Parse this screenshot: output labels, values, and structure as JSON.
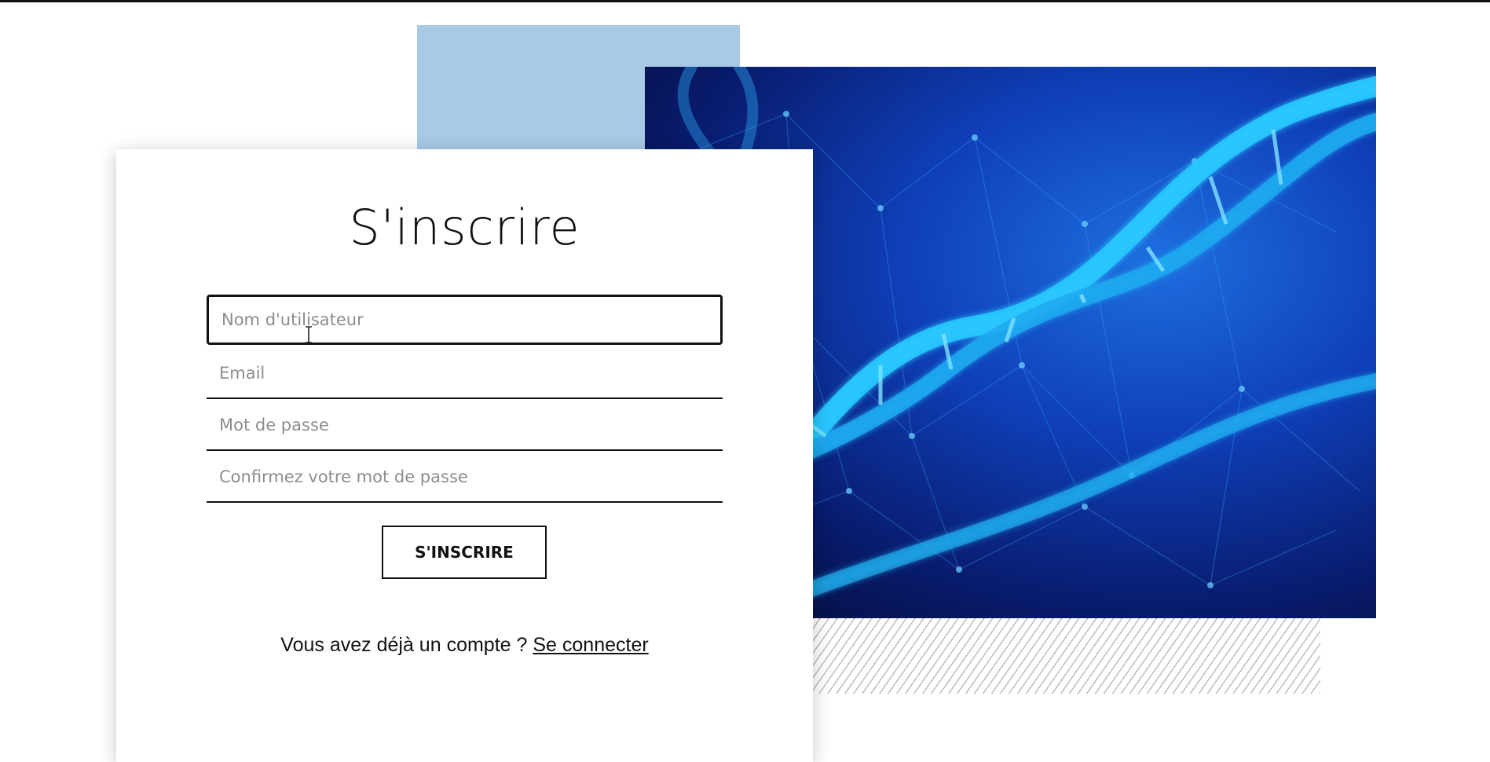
{
  "colors": {
    "accent_block": "#a9c9e6",
    "text": "#111111",
    "placeholder": "#8c8c8c",
    "hero_dna": "#29c8ff"
  },
  "hero": {
    "image_subject": "dna-helix-network"
  },
  "form": {
    "title": "S'inscrire",
    "fields": [
      {
        "placeholder": "Nom d'utilisateur",
        "value": ""
      },
      {
        "placeholder": "Email",
        "value": ""
      },
      {
        "placeholder": "Mot de passe",
        "value": ""
      },
      {
        "placeholder": "Confirmez votre mot de passe",
        "value": ""
      }
    ],
    "submit_label": "S'INSCRIRE",
    "footer_text": "Vous avez déjà un compte ?",
    "footer_link": "Se connecter"
  }
}
